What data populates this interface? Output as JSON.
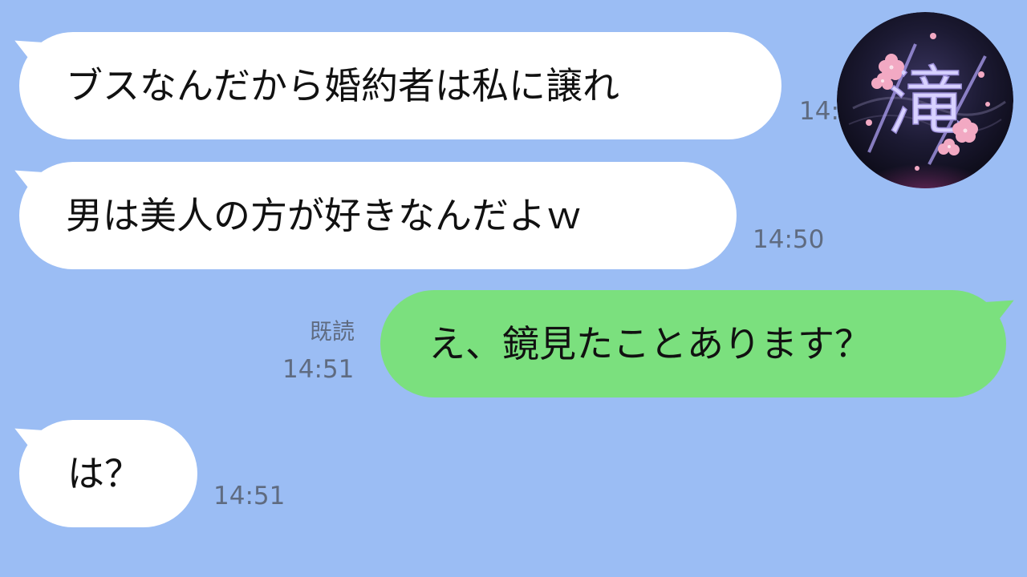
{
  "messages": [
    {
      "side": "incoming",
      "text": "ブスなんだから婚約者は私に譲れ",
      "time": "14:"
    },
    {
      "side": "incoming",
      "text": "男は美人の方が好きなんだよｗ",
      "time": "14:50"
    },
    {
      "side": "outgoing",
      "text": "え、鏡見たことあります？",
      "read": "既読",
      "time": "14:51"
    },
    {
      "side": "incoming",
      "text": "は？",
      "time": "14:51"
    }
  ],
  "avatar": {
    "glyph": "滝",
    "icon": "cherry-blossom-avatar-icon"
  },
  "colors": {
    "background": "#9bbdf4",
    "incoming_bubble": "#ffffff",
    "outgoing_bubble": "#7be07e",
    "meta_text": "#5f6b80"
  }
}
